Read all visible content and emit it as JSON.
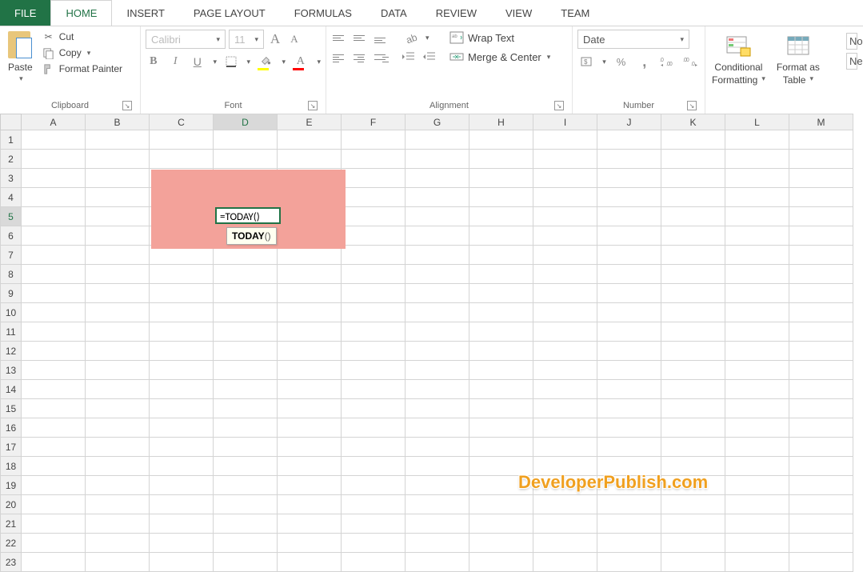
{
  "tabs": {
    "file": "FILE",
    "home": "HOME",
    "insert": "INSERT",
    "page_layout": "PAGE LAYOUT",
    "formulas": "FORMULAS",
    "data": "DATA",
    "review": "REVIEW",
    "view": "VIEW",
    "team": "TEAM"
  },
  "clipboard": {
    "paste": "Paste",
    "cut": "Cut",
    "copy": "Copy",
    "format_painter": "Format Painter",
    "group": "Clipboard"
  },
  "font": {
    "name": "Calibri",
    "size": "11",
    "bold": "B",
    "italic": "I",
    "underline": "U",
    "grow": "A",
    "shrink": "A",
    "color_letter": "A",
    "group": "Font"
  },
  "alignment": {
    "wrap": "Wrap Text",
    "merge": "Merge & Center",
    "group": "Alignment"
  },
  "number": {
    "format": "Date",
    "percent": "%",
    "comma": ",",
    "inc": ".0₀₀",
    "dec": ".0⁰",
    "group": "Number"
  },
  "styles": {
    "conditional": "Conditional",
    "formatting": "Formatting",
    "format_as": "Format as",
    "table": "Table",
    "no": "No",
    "ne": "Ne"
  },
  "grid": {
    "cols": [
      "A",
      "B",
      "C",
      "D",
      "E",
      "F",
      "G",
      "H",
      "I",
      "J",
      "K",
      "L",
      "M"
    ],
    "rows": [
      "1",
      "2",
      "3",
      "4",
      "5",
      "6",
      "7",
      "8",
      "9",
      "10",
      "11",
      "12",
      "13",
      "14",
      "15",
      "16",
      "17",
      "18",
      "19",
      "20",
      "21",
      "22",
      "23"
    ],
    "active_col": "D",
    "active_row": "5"
  },
  "cell": {
    "formula": "=TODAY()",
    "tooltip_bold": "TODAY",
    "tooltip_rest": "()"
  },
  "watermark": "DeveloperPublish.com"
}
